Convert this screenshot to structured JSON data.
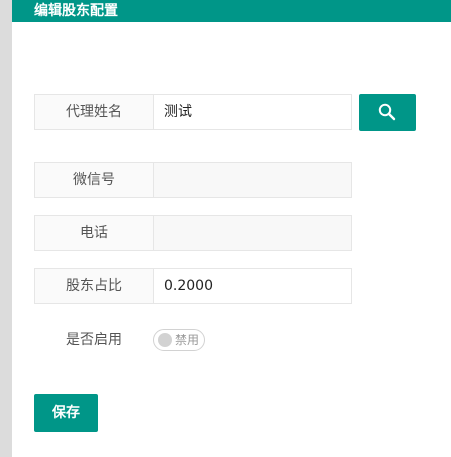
{
  "dialog": {
    "title": "编辑股东配置"
  },
  "form": {
    "agent_name": {
      "label": "代理姓名",
      "value": "测试"
    },
    "wechat": {
      "label": "微信号",
      "value": ""
    },
    "phone": {
      "label": "电话",
      "value": ""
    },
    "share_ratio": {
      "label": "股东占比",
      "value": "0.2000"
    },
    "enabled": {
      "label": "是否启用",
      "state_text": "禁用",
      "on": false
    }
  },
  "buttons": {
    "search_icon": "search-icon",
    "save_label": "保存"
  },
  "colors": {
    "accent": "#009688",
    "border": "#e6e6e6",
    "label_bg": "#fafafa"
  }
}
